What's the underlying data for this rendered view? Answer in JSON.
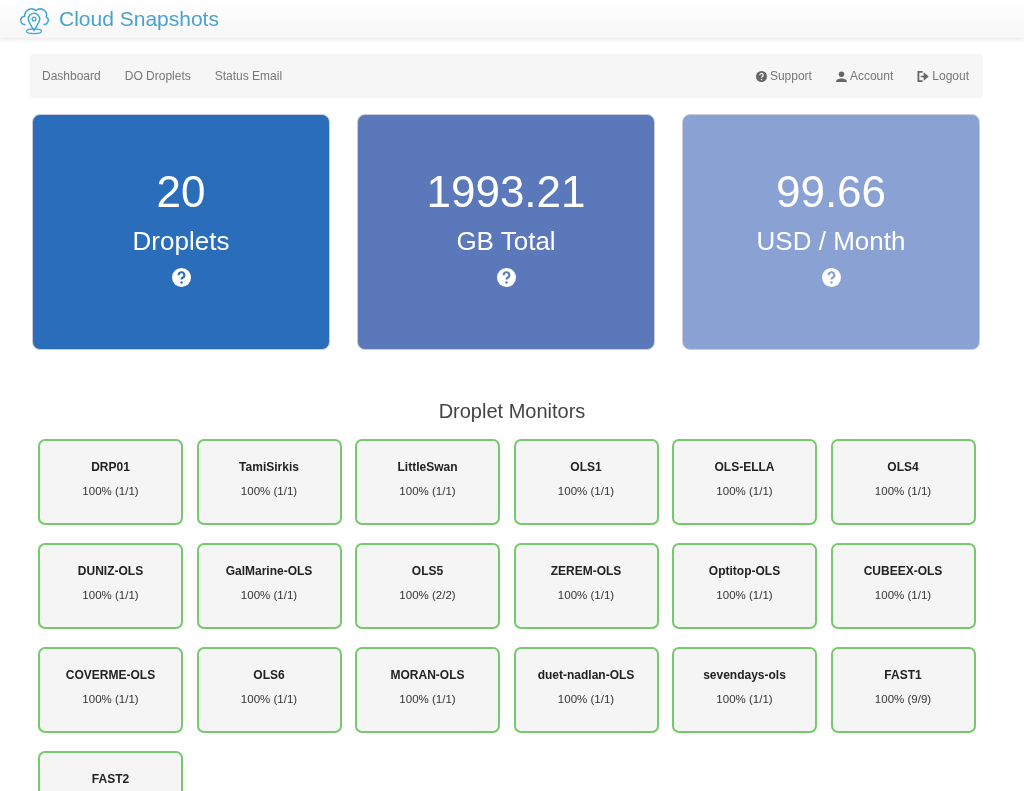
{
  "header": {
    "title": "Cloud Snapshots"
  },
  "nav": {
    "left": [
      {
        "label": "Dashboard"
      },
      {
        "label": "DO Droplets"
      },
      {
        "label": "Status Email"
      }
    ],
    "right": [
      {
        "label": "Support",
        "kind": "help"
      },
      {
        "label": "Account",
        "kind": "user"
      },
      {
        "label": "Logout",
        "kind": "logout"
      }
    ]
  },
  "stats": [
    {
      "value": "20",
      "label": "Droplets",
      "color": "#2a6ebb"
    },
    {
      "value": "1993.21",
      "label": "GB Total",
      "color": "#5b78ba"
    },
    {
      "value": "99.66",
      "label": "USD / Month",
      "color": "#8aa1d4"
    }
  ],
  "monitors": {
    "title": "Droplet Monitors",
    "items": [
      {
        "name": "DRP01",
        "status": "100% (1/1)"
      },
      {
        "name": "TamiSirkis",
        "status": "100% (1/1)"
      },
      {
        "name": "LittleSwan",
        "status": "100% (1/1)"
      },
      {
        "name": "OLS1",
        "status": "100% (1/1)"
      },
      {
        "name": "OLS-ELLA",
        "status": "100% (1/1)"
      },
      {
        "name": "OLS4",
        "status": "100% (1/1)"
      },
      {
        "name": "DUNIZ-OLS",
        "status": "100% (1/1)"
      },
      {
        "name": "GalMarine-OLS",
        "status": "100% (1/1)"
      },
      {
        "name": "OLS5",
        "status": "100% (2/2)"
      },
      {
        "name": "ZEREM-OLS",
        "status": "100% (1/1)"
      },
      {
        "name": "Optitop-OLS",
        "status": "100% (1/1)"
      },
      {
        "name": "CUBEEX-OLS",
        "status": "100% (1/1)"
      },
      {
        "name": "COVERME-OLS",
        "status": "100% (1/1)"
      },
      {
        "name": "OLS6",
        "status": "100% (1/1)"
      },
      {
        "name": "MORAN-OLS",
        "status": "100% (1/1)"
      },
      {
        "name": "duet-nadlan-OLS",
        "status": "100% (1/1)"
      },
      {
        "name": "sevendays-ols",
        "status": "100% (1/1)"
      },
      {
        "name": "FAST1",
        "status": "100% (9/9)"
      },
      {
        "name": "FAST2"
      }
    ]
  }
}
